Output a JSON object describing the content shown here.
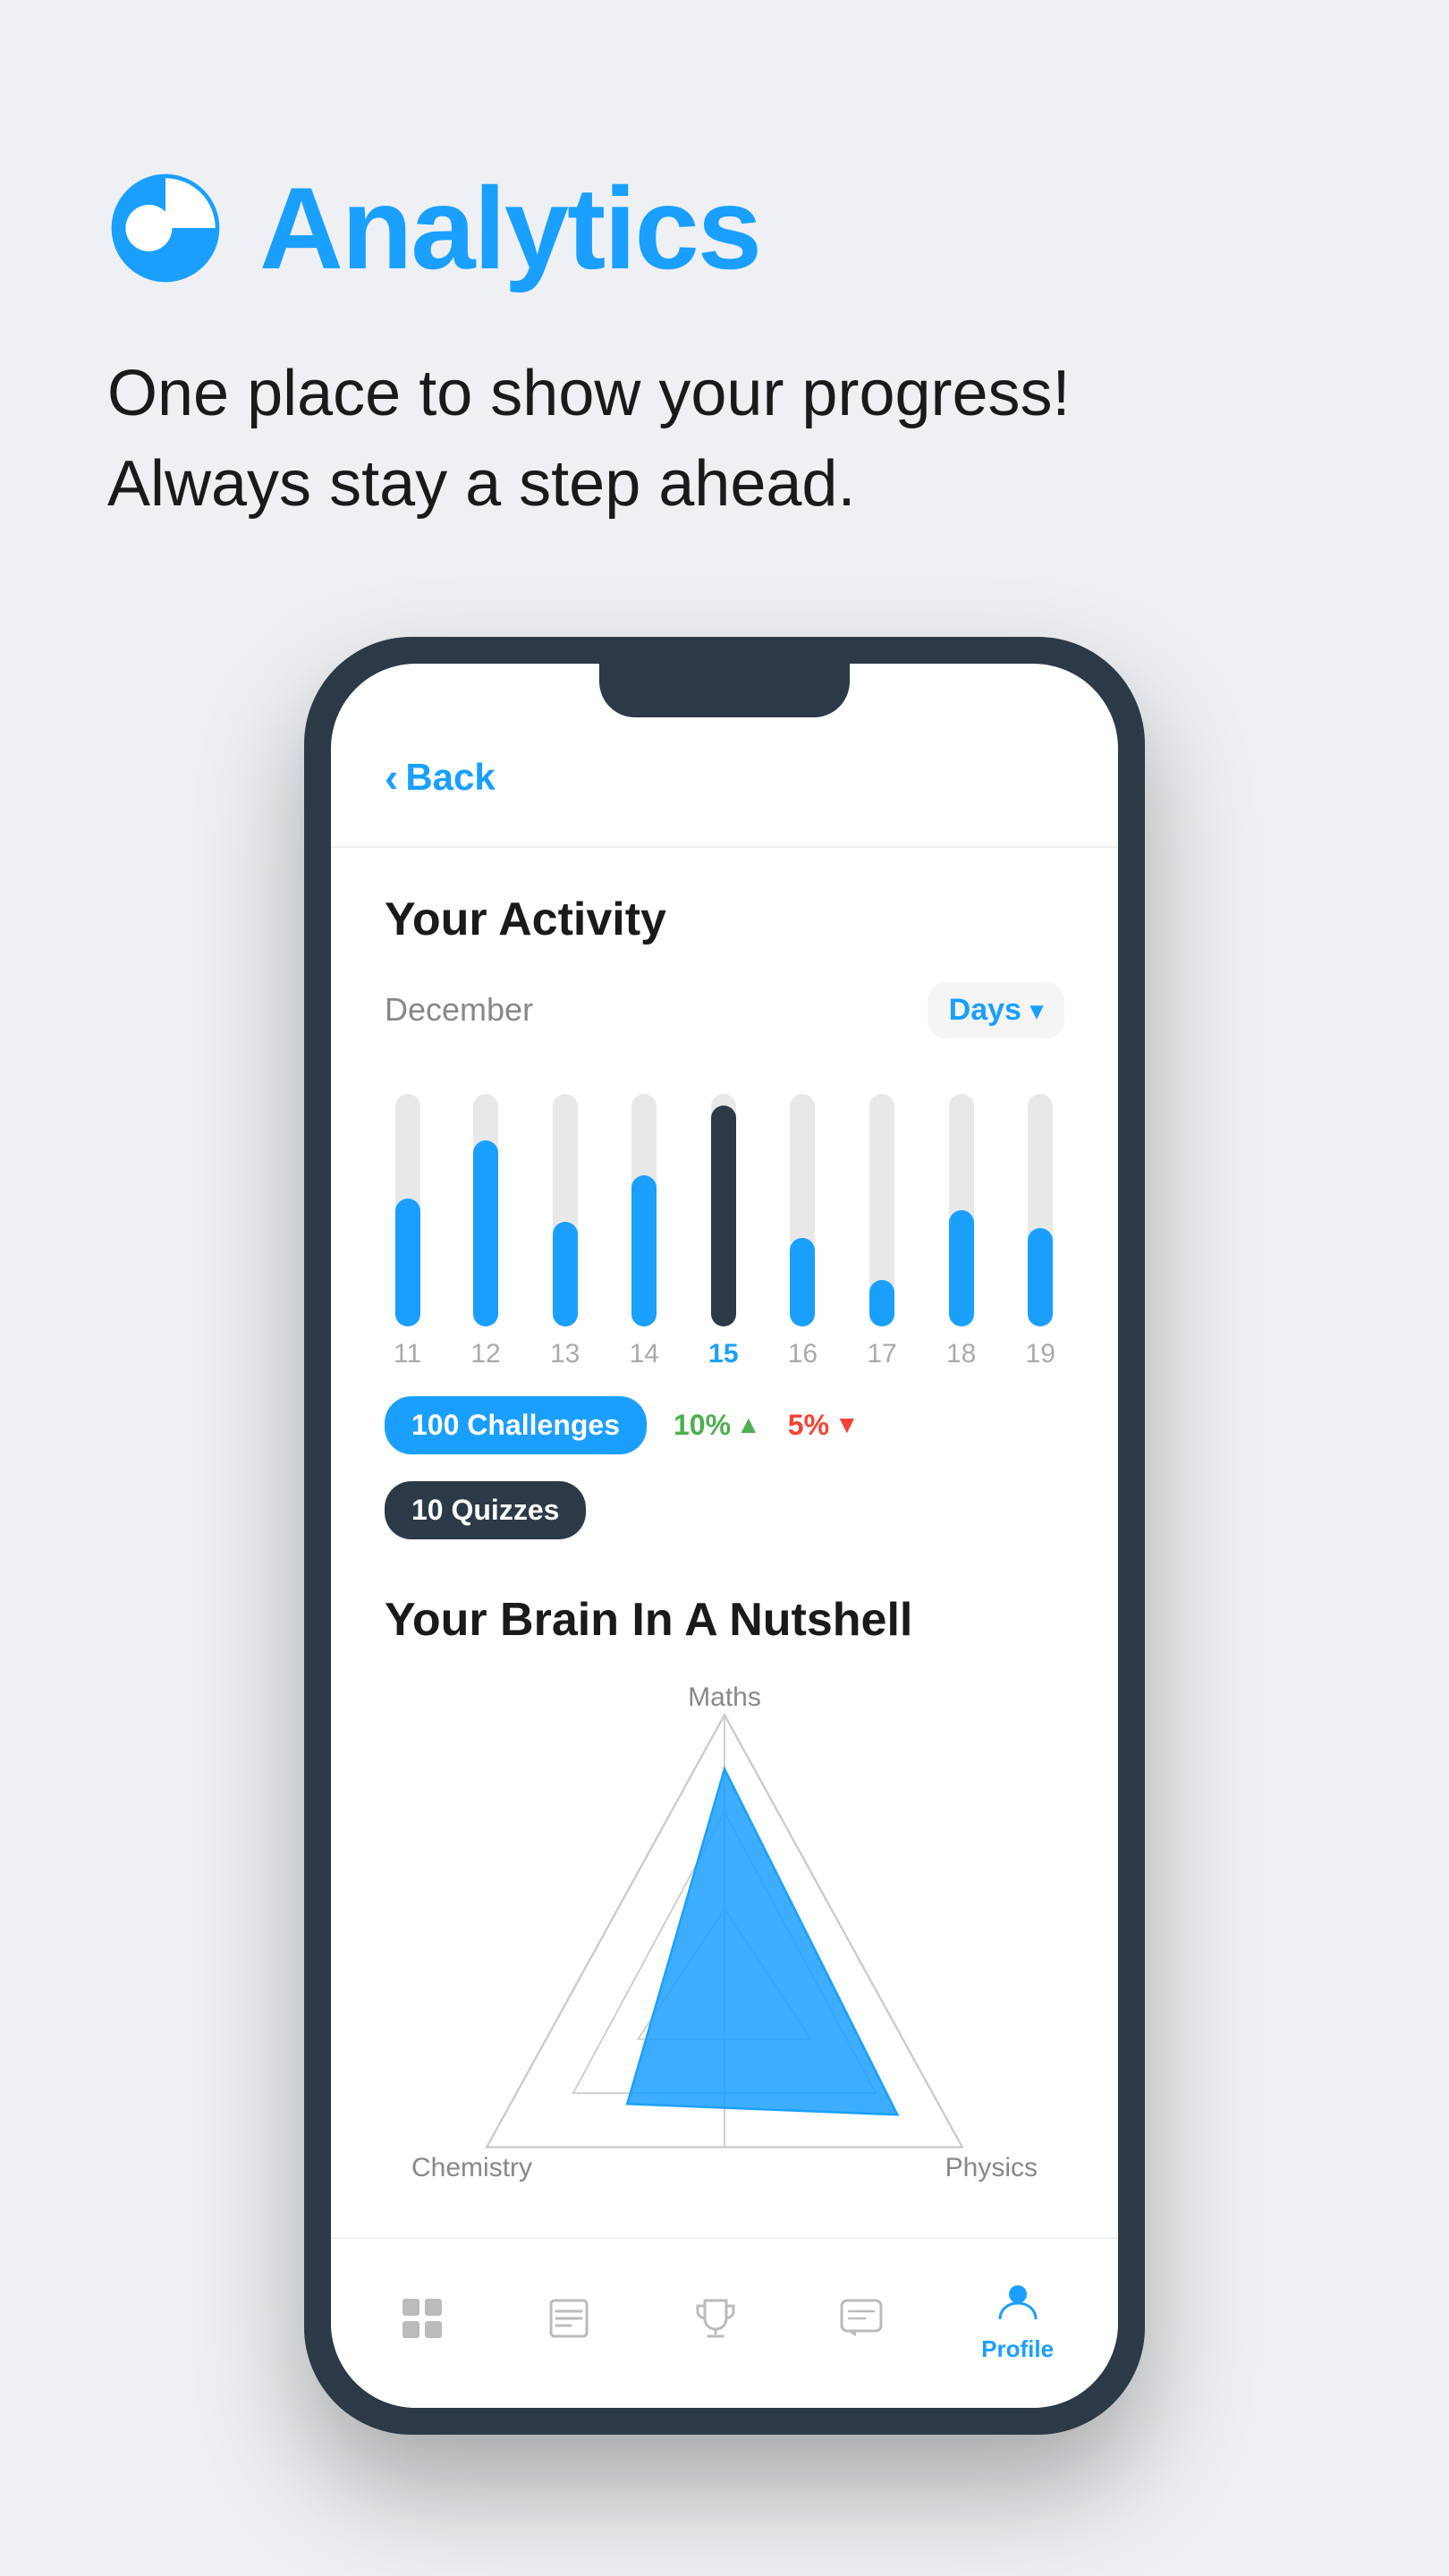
{
  "page": {
    "background": "#eef0f3"
  },
  "header": {
    "title": "Analytics",
    "icon_alt": "analytics-pie-icon",
    "subtitle_line1": "One place to show your progress!",
    "subtitle_line2": "Always stay a step ahead.",
    "accent_color": "#1a9fff"
  },
  "phone": {
    "back_label": "Back",
    "activity_section": {
      "title": "Your Activity",
      "month": "December",
      "filter_label": "Days",
      "bars": [
        {
          "day": "11",
          "height_pct": 55,
          "active": false,
          "dark": false
        },
        {
          "day": "12",
          "height_pct": 80,
          "active": false,
          "dark": false
        },
        {
          "day": "13",
          "height_pct": 45,
          "active": false,
          "dark": false
        },
        {
          "day": "14",
          "height_pct": 65,
          "active": false,
          "dark": false
        },
        {
          "day": "15",
          "height_pct": 95,
          "active": true,
          "dark": true
        },
        {
          "day": "16",
          "height_pct": 38,
          "active": false,
          "dark": false
        },
        {
          "day": "17",
          "height_pct": 20,
          "active": false,
          "dark": false
        },
        {
          "day": "18",
          "height_pct": 50,
          "active": false,
          "dark": false
        },
        {
          "day": "19",
          "height_pct": 42,
          "active": false,
          "dark": false
        }
      ],
      "stats": [
        {
          "label": "100 Challenges",
          "type": "badge_blue"
        },
        {
          "label": "10%",
          "type": "percent_green",
          "arrow": "up"
        },
        {
          "label": "5%",
          "type": "percent_red",
          "arrow": "down"
        },
        {
          "label": "10 Quizzes",
          "type": "badge_dark"
        }
      ]
    },
    "brain_section": {
      "title": "Your Brain In A Nutshell",
      "labels": {
        "top": "Maths",
        "bottom_left": "Chemistry",
        "bottom_right": "Physics"
      }
    },
    "bottom_nav": {
      "items": [
        {
          "id": "home",
          "label": "",
          "active": false
        },
        {
          "id": "lessons",
          "label": "",
          "active": false
        },
        {
          "id": "trophy",
          "label": "",
          "active": false
        },
        {
          "id": "chat",
          "label": "",
          "active": false
        },
        {
          "id": "profile",
          "label": "Profile",
          "active": true
        }
      ]
    }
  }
}
